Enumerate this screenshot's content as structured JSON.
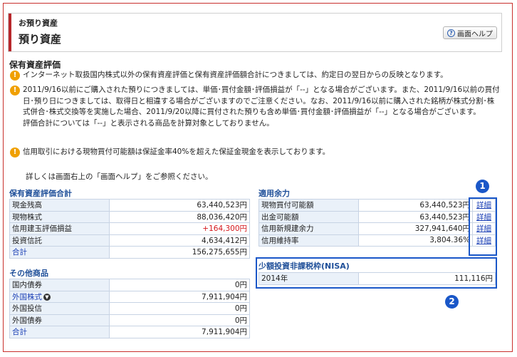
{
  "header": {
    "subtitle": "お預り資産",
    "title": "預り資産",
    "help_label": "画面ヘルプ"
  },
  "section": {
    "title": "保有資産評価",
    "notices": [
      "インターネット取扱国内株式以外の保有資産評価と保有資産評価額合計につきましては、約定日の翌日からの反映となります。",
      "2011/9/16以前にご購入された預りにつきましては、単価･買付金額･評価損益が「--」となる場合がございます。また、2011/9/16以前の買付日･預り日につきましては、取得日と相違する場合がございますのでご注意ください。なお、2011/9/16以前に購入された銘柄が株式分割･株式併合･株式交換等を実施した場合、2011/9/20以降に買付された預りも含め単価･買付金額･評価損益が「--」となる場合がございます。",
      "信用取引における現物買付可能額は保証金率40%を超えた保証金現金を表示しております。"
    ],
    "notice2_extra": "評価合計については「--」と表示される商品を計算対象としておりません。",
    "detail_note": "詳しくは画面右上の「画面ヘルプ」をご参照ください。"
  },
  "holdings": {
    "title": "保有資産評価合計",
    "rows": [
      {
        "label": "現金残高",
        "value": "63,440,523円"
      },
      {
        "label": "現物株式",
        "value": "88,036,420円"
      },
      {
        "label": "信用建玉評価損益",
        "value": "+164,300円"
      },
      {
        "label": "投資信託",
        "value": "4,634,412円"
      },
      {
        "label": "合計",
        "value": "156,275,655円"
      }
    ]
  },
  "others": {
    "title": "その他商品",
    "rows": [
      {
        "label": "国内債券",
        "value": "0円"
      },
      {
        "label": "外国株式",
        "value": "7,911,904円"
      },
      {
        "label": "外国投信",
        "value": "0円"
      },
      {
        "label": "外国債券",
        "value": "0円"
      },
      {
        "label": "合計",
        "value": "7,911,904円"
      }
    ]
  },
  "margin": {
    "title": "適用余力",
    "link_label": "詳細",
    "rows": [
      {
        "label": "現物買付可能額",
        "value": "63,440,523円"
      },
      {
        "label": "出金可能額",
        "value": "63,440,523円"
      },
      {
        "label": "信用新規建余力",
        "value": "327,941,640円"
      },
      {
        "label": "信用維持率",
        "value": "3,804.36%"
      }
    ]
  },
  "nisa": {
    "title": "少額投資非課税枠(NISA)",
    "rows": [
      {
        "label": "2014年",
        "value": "111,116円"
      }
    ]
  },
  "badges": {
    "one": "1",
    "two": "2"
  },
  "colors": {
    "accent": "#b8272b",
    "link": "#1a3fb5",
    "highlight": "#1a57c8",
    "warning": "#f0a000",
    "gain": "#d4161b"
  }
}
